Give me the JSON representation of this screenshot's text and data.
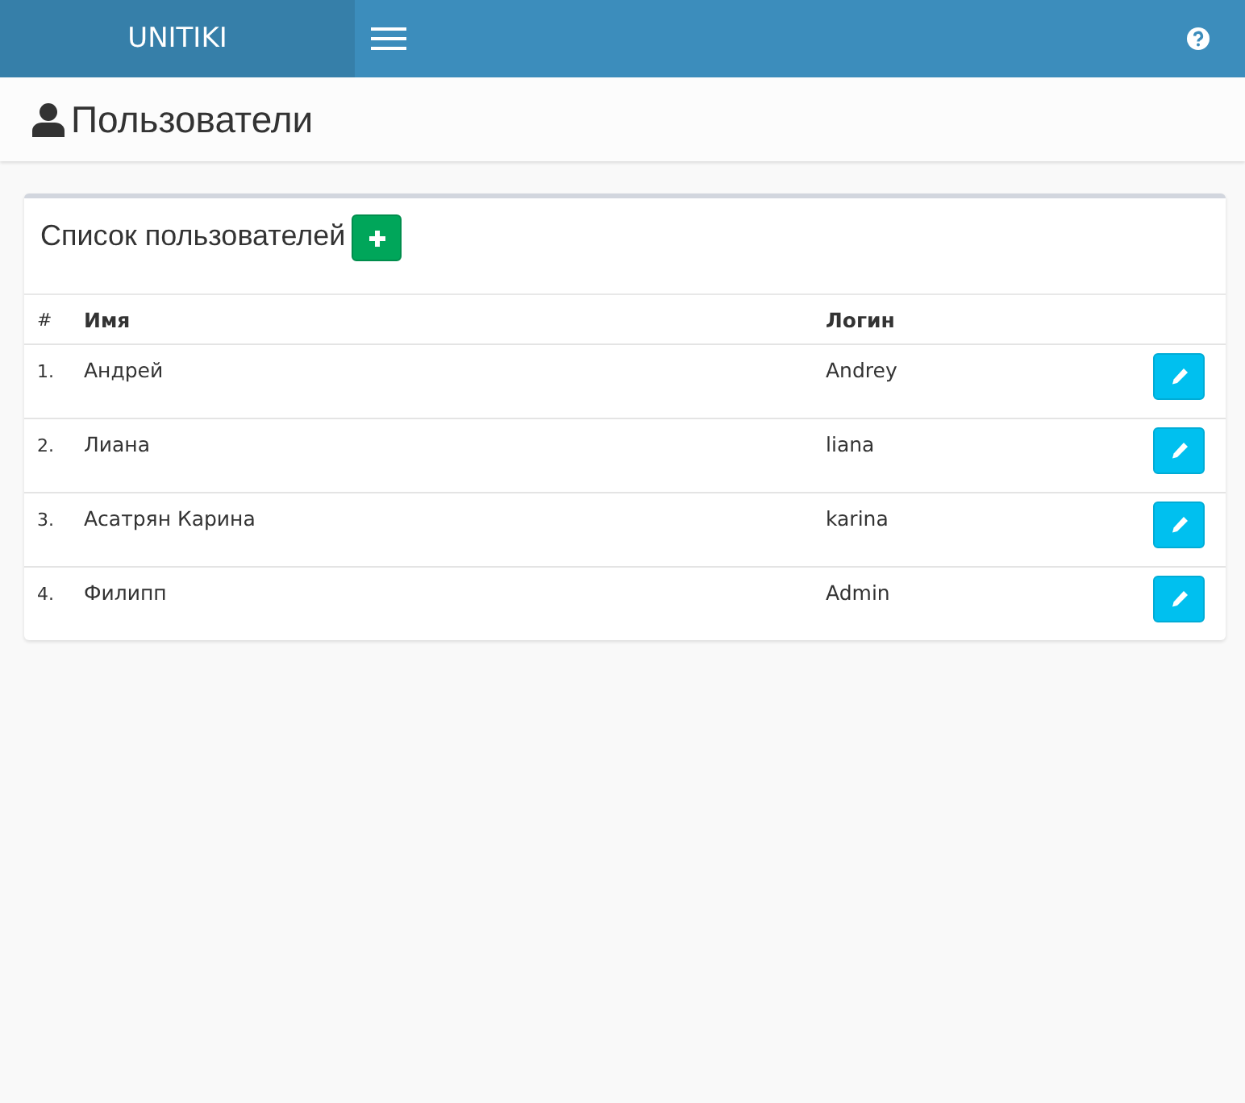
{
  "header": {
    "brand": "UNITIKI"
  },
  "page": {
    "title": "Пользователи"
  },
  "card": {
    "title": "Список пользователей",
    "table": {
      "columns": [
        "#",
        "Имя",
        "Логин"
      ],
      "rows": [
        {
          "number": "1.",
          "name": "Андрей",
          "login": "Andrey"
        },
        {
          "number": "2.",
          "name": "Лиана",
          "login": "liana"
        },
        {
          "number": "3.",
          "name": "Асатрян Карина",
          "login": "karina"
        },
        {
          "number": "4.",
          "name": "Филипп",
          "login": "Admin"
        }
      ]
    }
  }
}
